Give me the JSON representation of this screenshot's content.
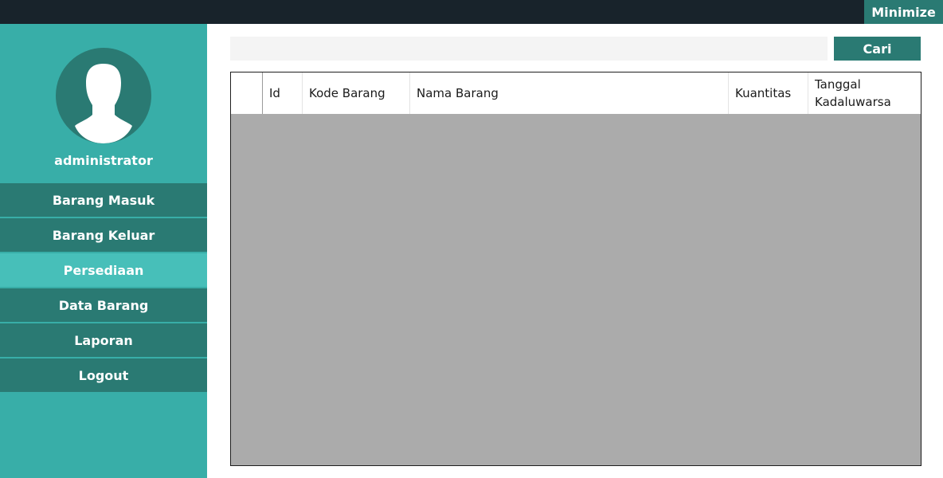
{
  "window": {
    "minimize_label": "Minimize"
  },
  "sidebar": {
    "username": "administrator",
    "items": [
      {
        "label": "Barang Masuk",
        "active": false
      },
      {
        "label": "Barang Keluar",
        "active": false
      },
      {
        "label": "Persediaan",
        "active": true
      },
      {
        "label": "Data Barang",
        "active": false
      },
      {
        "label": "Laporan",
        "active": false
      },
      {
        "label": "Logout",
        "active": false
      }
    ]
  },
  "search": {
    "value": "",
    "placeholder": "",
    "button_label": "Cari"
  },
  "table": {
    "columns": [
      "Id",
      "Kode Barang",
      "Nama Barang",
      "Kuantitas",
      "Tanggal Kadaluwarsa"
    ],
    "rows": []
  },
  "colors": {
    "titlebar": "#18232b",
    "sidebar": "#38aea8",
    "accent_dark": "#2a7a73",
    "active_item": "#47bfb9",
    "grid_empty": "#ababab"
  },
  "icons": {
    "avatar": "user-silhouette-icon"
  }
}
